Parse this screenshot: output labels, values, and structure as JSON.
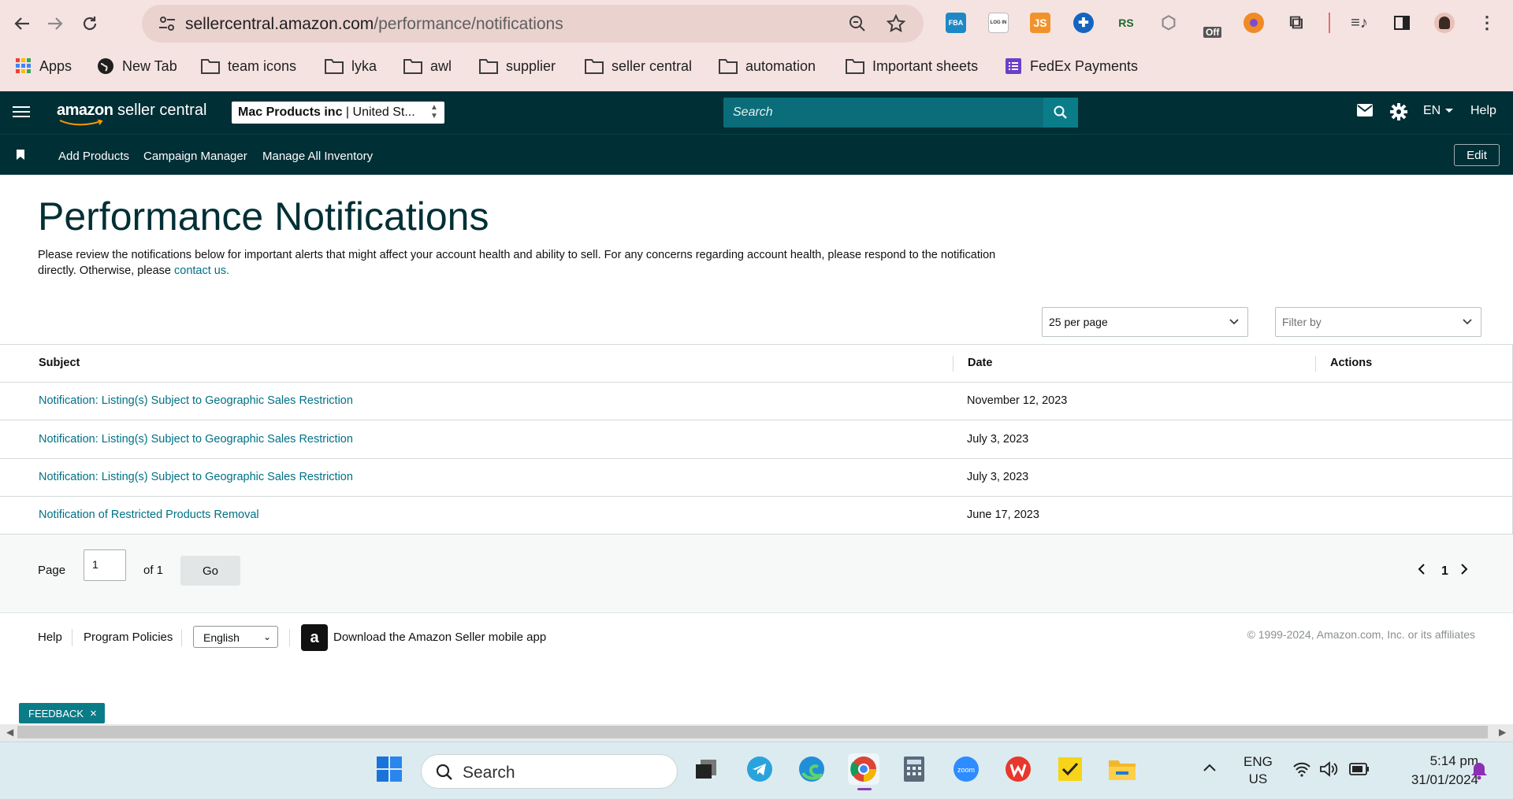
{
  "browser": {
    "url_domain": "sellercentral.amazon.com",
    "url_path": "/performance/notifications",
    "extensions": [
      {
        "name": "fba-extension-icon",
        "label": "FBA",
        "color": "#1e88c7"
      },
      {
        "name": "login-extension-icon",
        "label": "LOG IN",
        "color": "#ffffff"
      },
      {
        "name": "js-extension-icon",
        "label": "JS",
        "color": "#f0932b"
      },
      {
        "name": "puzzle-blue-extension-icon",
        "label": "",
        "color": "#1565c0"
      },
      {
        "name": "rs-extension-icon",
        "label": "RS",
        "color": "#ffffff"
      },
      {
        "name": "cube-extension-icon",
        "label": "",
        "color": "#ffffff"
      },
      {
        "name": "off-extension-icon",
        "label": "Off",
        "color": "#555555"
      },
      {
        "name": "firefox-extension-icon",
        "label": "",
        "color": "#f08a24"
      }
    ],
    "bookmarks": [
      {
        "label": "Apps",
        "icon": "apps-grid-icon"
      },
      {
        "label": "New Tab",
        "icon": "globe-icon"
      },
      {
        "label": "team icons",
        "icon": "folder-icon"
      },
      {
        "label": "lyka",
        "icon": "folder-icon"
      },
      {
        "label": "awl",
        "icon": "folder-icon"
      },
      {
        "label": "supplier",
        "icon": "folder-icon"
      },
      {
        "label": "seller central",
        "icon": "folder-icon"
      },
      {
        "label": "automation",
        "icon": "folder-icon"
      },
      {
        "label": "Important sheets",
        "icon": "folder-icon"
      },
      {
        "label": "FedEx Payments",
        "icon": "form-icon"
      }
    ]
  },
  "header": {
    "logo_brand": "amazon",
    "logo_product": " seller central",
    "account_name": "Mac Products inc",
    "account_region": " | United St...",
    "search_placeholder": "Search",
    "language": "EN",
    "help": "Help"
  },
  "subnav": {
    "links": [
      "Add Products",
      "Campaign Manager",
      "Manage All Inventory"
    ],
    "edit_label": "Edit"
  },
  "page": {
    "title": "Performance Notifications",
    "description": "Please review the notifications below for important alerts that might affect your account health and ability to sell. For any concerns regarding account health, please respond to the notification directly. Otherwise, please",
    "contact_link": "contact us.",
    "per_page": "25 per page",
    "filter_placeholder": "Filter by"
  },
  "table": {
    "columns": [
      "Subject",
      "Date",
      "Actions"
    ],
    "rows": [
      {
        "subject": "Notification: Listing(s) Subject to Geographic Sales Restriction",
        "date": "November 12, 2023"
      },
      {
        "subject": "Notification: Listing(s) Subject to Geographic Sales Restriction",
        "date": "July 3, 2023"
      },
      {
        "subject": "Notification: Listing(s) Subject to Geographic Sales Restriction",
        "date": "July 3, 2023"
      },
      {
        "subject": "Notification of Restricted Products Removal",
        "date": "June 17, 2023"
      }
    ]
  },
  "pagination": {
    "page_label": "Page",
    "page_value": "1",
    "of_label": "of 1",
    "go_label": "Go",
    "current_page": "1"
  },
  "footer": {
    "help": "Help",
    "program_policies": "Program Policies",
    "language": "English",
    "app_icon_letter": "a",
    "download_app": "Download the Amazon Seller mobile app",
    "copyright": "© 1999-2024, Amazon.com, Inc. or its affiliates"
  },
  "feedback": {
    "label": "FEEDBACK"
  },
  "taskbar": {
    "search_placeholder": "Search",
    "lang_line1": "ENG",
    "lang_line2": "US",
    "time": "5:14 pm",
    "date": "31/01/2024"
  },
  "colors": {
    "header_bg": "#002f36",
    "link": "#007185",
    "chrome_bg": "#f5e3e1"
  }
}
